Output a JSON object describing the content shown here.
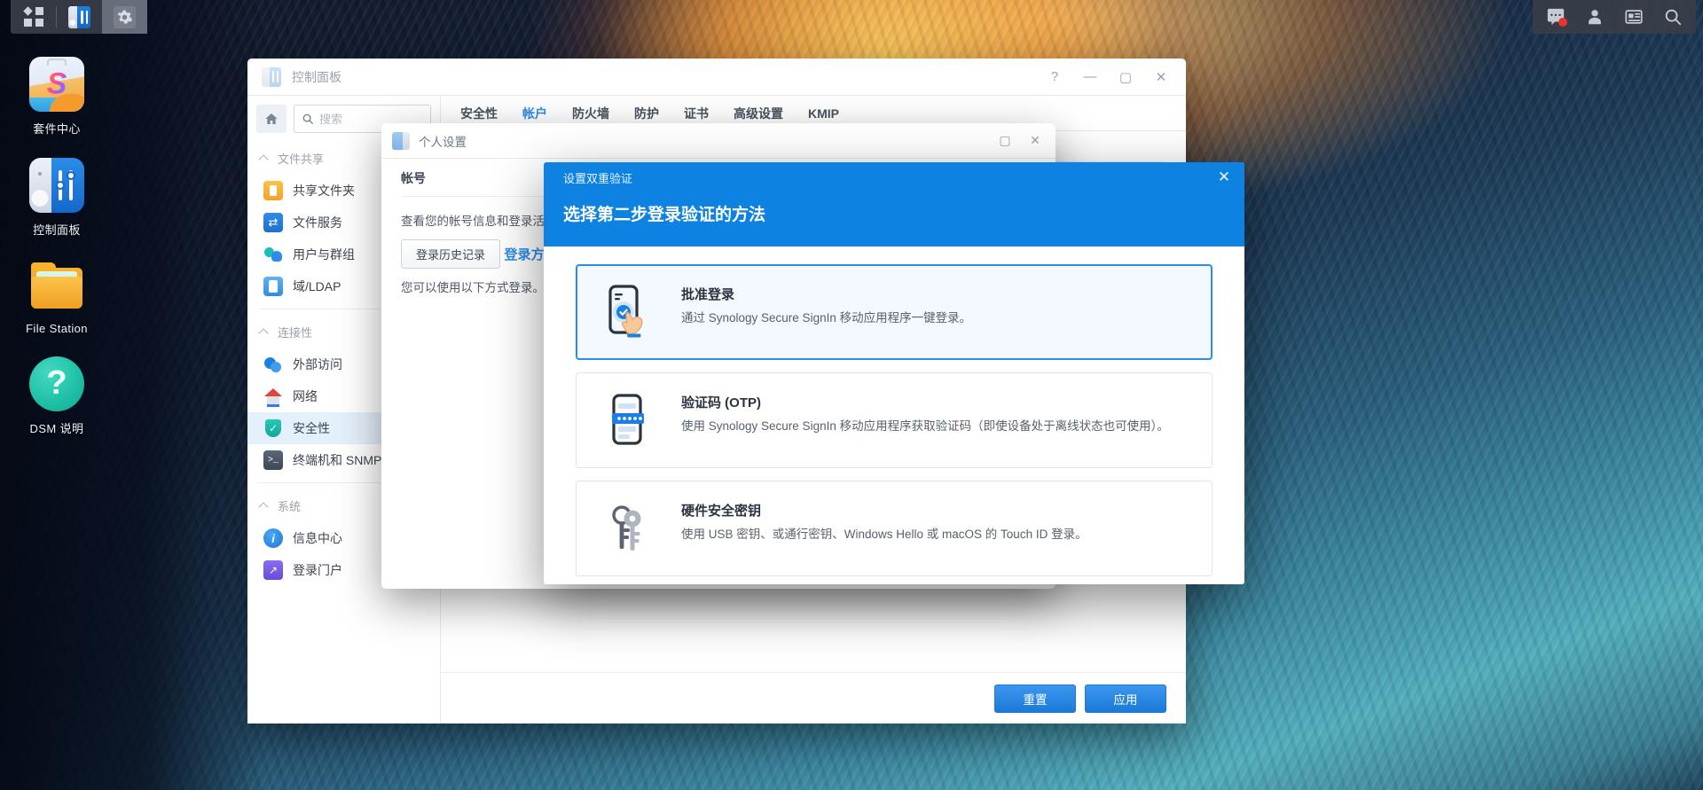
{
  "taskbar": {
    "left_icons": [
      {
        "name": "app-grid-icon",
        "label": "主选单"
      },
      {
        "name": "taskbar-control-panel-icon",
        "label": "控制面板"
      },
      {
        "name": "taskbar-settings-icon",
        "label": "设置"
      }
    ],
    "right_icons": [
      {
        "name": "notifications-icon",
        "label": "通知",
        "badge": true
      },
      {
        "name": "user-account-icon",
        "label": "个人设置"
      },
      {
        "name": "widgets-icon",
        "label": "小工具"
      },
      {
        "name": "search-icon",
        "label": "搜索"
      }
    ]
  },
  "desktop_icons": [
    {
      "label": "套件中心",
      "icon": "package-center-icon"
    },
    {
      "label": "控制面板",
      "icon": "control-panel-icon"
    },
    {
      "label": "File Station",
      "icon": "file-station-icon"
    },
    {
      "label": "DSM 说明",
      "icon": "dsm-help-icon"
    }
  ],
  "control_panel": {
    "title": "控制面板",
    "window_buttons": {
      "help": "?",
      "minimize": "—",
      "maximize": "▢",
      "close": "✕"
    },
    "search": {
      "placeholder": "搜索",
      "value": ""
    },
    "sidebar": [
      {
        "type": "group",
        "label": "文件共享",
        "icon": "chevron-up-icon"
      },
      {
        "type": "item",
        "label": "共享文件夹",
        "icon": "shared-folder-icon"
      },
      {
        "type": "item",
        "label": "文件服务",
        "icon": "file-services-icon"
      },
      {
        "type": "item",
        "label": "用户与群组",
        "icon": "users-groups-icon"
      },
      {
        "type": "item",
        "label": "域/LDAP",
        "icon": "domain-ldap-icon"
      },
      {
        "type": "divider"
      },
      {
        "type": "group",
        "label": "连接性",
        "icon": "chevron-up-icon"
      },
      {
        "type": "item",
        "label": "外部访问",
        "icon": "external-access-icon"
      },
      {
        "type": "item",
        "label": "网络",
        "icon": "network-icon"
      },
      {
        "type": "item",
        "label": "安全性",
        "icon": "security-shield-icon",
        "selected": true
      },
      {
        "type": "item",
        "label": "终端机和 SNMP",
        "icon": "terminal-snmp-icon"
      },
      {
        "type": "divider"
      },
      {
        "type": "group",
        "label": "系统",
        "icon": "chevron-up-icon"
      },
      {
        "type": "item",
        "label": "信息中心",
        "icon": "info-center-icon"
      },
      {
        "type": "item",
        "label": "登录门户",
        "icon": "login-portal-icon"
      }
    ],
    "tabs": [
      {
        "label": "安全性",
        "active": false
      },
      {
        "label": "帐户",
        "active": true
      },
      {
        "label": "防火墙",
        "active": false
      },
      {
        "label": "防护",
        "active": false
      },
      {
        "label": "证书",
        "active": false
      },
      {
        "label": "高级设置",
        "active": false
      },
      {
        "label": "KMIP",
        "active": false
      }
    ],
    "footer_buttons": [
      {
        "label": "重置",
        "style": "blue"
      },
      {
        "label": "应用",
        "style": "blue"
      }
    ]
  },
  "personal_window": {
    "title": "个人设置",
    "tabs": [
      {
        "label": "帐号",
        "active": true
      }
    ],
    "body_text": "查看您的帐号信息和登录活动记录。",
    "history_button": "登录历史记录",
    "section_link": "登录方式",
    "section_desc": "您可以使用以下方式登录。",
    "window_buttons": {
      "maximize": "▢",
      "close": "✕"
    }
  },
  "modal": {
    "window_title": "设置双重验证",
    "heading": "选择第二步登录验证的方法",
    "close_label": "✕",
    "accent_color": "#0d82e0",
    "options": [
      {
        "icon": "phone-approve-icon",
        "title": "批准登录",
        "desc": "通过 Synology Secure SignIn 移动应用程序一键登录。",
        "selected": true
      },
      {
        "icon": "phone-otp-icon",
        "title": "验证码 (OTP)",
        "desc": "使用 Synology Secure SignIn 移动应用程序获取验证码（即使设备处于离线状态也可使用）。",
        "selected": false
      },
      {
        "icon": "security-key-icon",
        "title": "硬件安全密钥",
        "desc": "使用 USB 密钥、或通行密钥、Windows Hello 或 macOS 的 Touch ID 登录。",
        "selected": false
      }
    ]
  }
}
